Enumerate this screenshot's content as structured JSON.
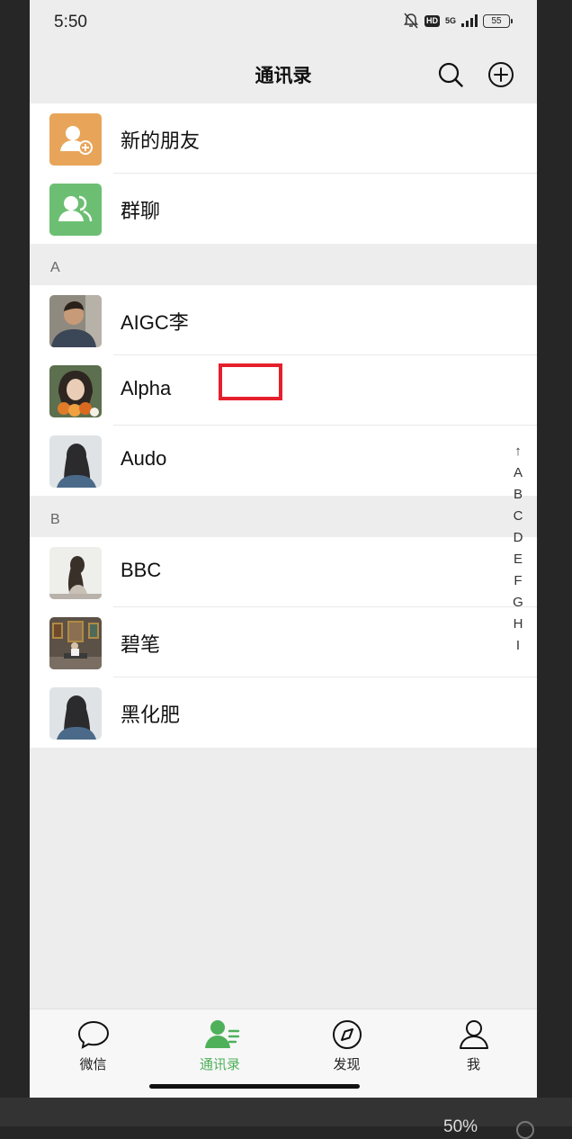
{
  "status_bar": {
    "time": "5:50",
    "hd": "HD",
    "network": "5G",
    "battery": "55"
  },
  "header": {
    "title": "通讯录"
  },
  "top_entries": [
    {
      "label": "新的朋友",
      "icon": "add-friend-icon",
      "color": "#E8A55A"
    },
    {
      "label": "群聊",
      "icon": "group-chat-icon",
      "color": "#6CBF72"
    }
  ],
  "sections": [
    {
      "letter": "A",
      "contacts": [
        {
          "name": "AIGC李"
        },
        {
          "name": "Alpha"
        },
        {
          "name": "Audo"
        }
      ]
    },
    {
      "letter": "B",
      "contacts": [
        {
          "name": "BBC"
        },
        {
          "name": "碧笔"
        },
        {
          "name": "黑化肥"
        }
      ]
    }
  ],
  "index_bar": [
    "↑",
    "A",
    "B",
    "C",
    "D",
    "E",
    "F",
    "G",
    "H",
    "I"
  ],
  "tabs": [
    {
      "label": "微信",
      "icon": "chat-bubble-icon",
      "active": false
    },
    {
      "label": "通讯录",
      "icon": "contacts-icon",
      "active": true
    },
    {
      "label": "发现",
      "icon": "compass-icon",
      "active": false
    },
    {
      "label": "我",
      "icon": "person-icon",
      "active": false
    }
  ],
  "colors": {
    "accent": "#4FB05A",
    "highlight": "#E5202C",
    "background": "#EDEDED"
  },
  "bottom_overlay": {
    "text": "50%"
  }
}
